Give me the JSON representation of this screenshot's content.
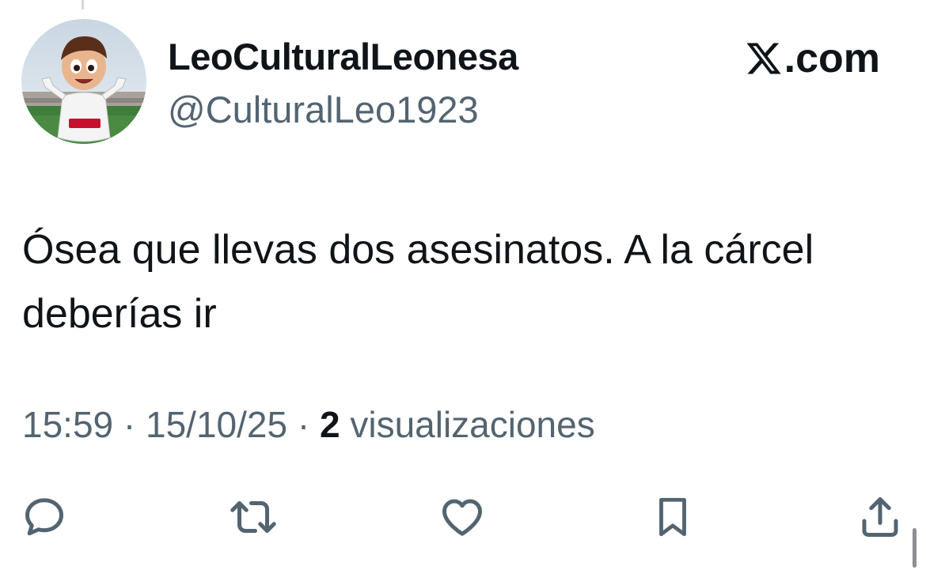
{
  "account": {
    "display_name": "LeoCulturalLeonesa",
    "handle": "@CulturalLeo1923",
    "avatar_icon": "mascot-avatar"
  },
  "brand": {
    "label": ".com",
    "icon": "x-logo-icon"
  },
  "tweet": {
    "text": "Ósea que llevas dos asesinatos. A la cárcel deberías ir"
  },
  "meta": {
    "time": "15:59",
    "separator": " · ",
    "date": "15/10/25",
    "views_count": "2",
    "views_label": " visualizaciones"
  },
  "actions": [
    {
      "name": "reply",
      "icon": "reply-icon"
    },
    {
      "name": "retweet",
      "icon": "retweet-icon"
    },
    {
      "name": "like",
      "icon": "heart-icon"
    },
    {
      "name": "bookmark",
      "icon": "bookmark-icon"
    },
    {
      "name": "share",
      "icon": "share-icon"
    }
  ],
  "colors": {
    "text_primary": "#0f1419",
    "text_secondary": "#536471",
    "icon": "#536471"
  }
}
